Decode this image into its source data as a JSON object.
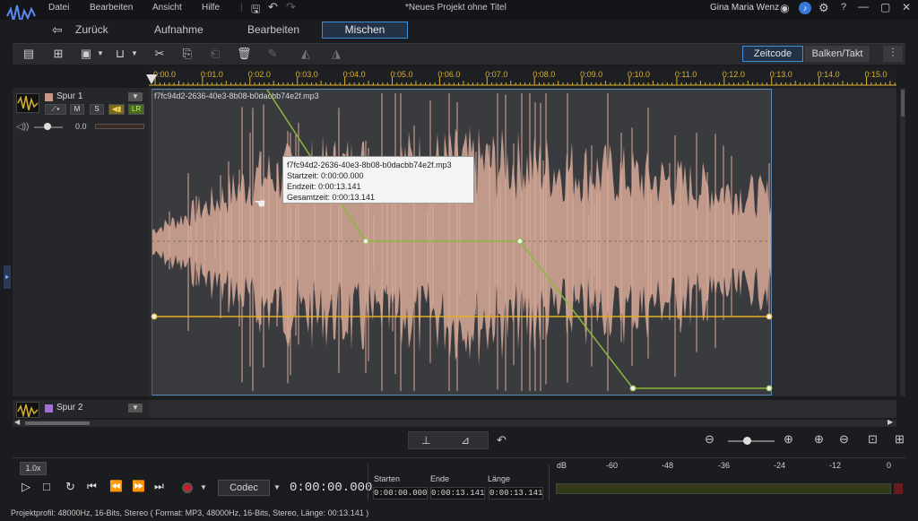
{
  "menu": {
    "items": [
      "Datei",
      "Bearbeiten",
      "Ansicht",
      "Hilfe"
    ],
    "window_title": "*Neues Projekt ohne Titel",
    "user_name": "Gina Maria Wenz"
  },
  "nav": {
    "back_label": "Zurück",
    "tabs": [
      "Aufnahme",
      "Bearbeiten",
      "Mischen"
    ]
  },
  "toolbar": {
    "zeitcode_label": "Zeitcode",
    "balken_label": "Balken/Takt"
  },
  "ruler": {
    "ticks": [
      "0:00.0",
      "0:01.0",
      "0:02.0",
      "0:03.0",
      "0:04.0",
      "0:05.0",
      "0:06.0",
      "0:07.0",
      "0:08.0",
      "0:09.0",
      "0:10.0",
      "0:11.0",
      "0:12.0",
      "0:13.0",
      "0:14.0",
      "0:15.0"
    ]
  },
  "track1": {
    "name": "Spur 1",
    "mute_label": "M",
    "solo_label": "S",
    "lr_label": "LR",
    "volume_value": "0.0",
    "color": "#c9968a"
  },
  "track2": {
    "name": "Spur 2",
    "color": "#a070d0"
  },
  "clip": {
    "filename": "f7fc94d2-2636-40e3-8b08-b0dacbb74e2f.mp3",
    "waveform_color": "#d8aa98",
    "envelope_color": "#8ab83a",
    "volume_line_color": "#e2b020"
  },
  "tooltip": {
    "title": "f7fc94d2-2636-40e3-8b08-b0dacbb74e2f.mp3",
    "start": "Startzeit: 0:00:00.000",
    "end": "Endzeit: 0:00:13.141",
    "total": "Gesamtzeit: 0:00:13.141"
  },
  "transport": {
    "speed": "1.0x",
    "codec_label": "Codec",
    "time_display": "0:00:00.000",
    "start_label": "Starten",
    "end_label": "Ende",
    "length_label": "Länge",
    "start_value": "0:00:00.000",
    "end_value": "0:00:13.141",
    "length_value": "0:00:13.141"
  },
  "meter": {
    "labels": [
      "dB",
      "-60",
      "-48",
      "-36",
      "-24",
      "-12",
      "0"
    ]
  },
  "status": {
    "text": "Projektprofil: 48000Hz, 16-Bits, Stereo ( Format: MP3, 48000Hz, 16-Bits, Stereo, Länge: 00:13.141 )"
  }
}
